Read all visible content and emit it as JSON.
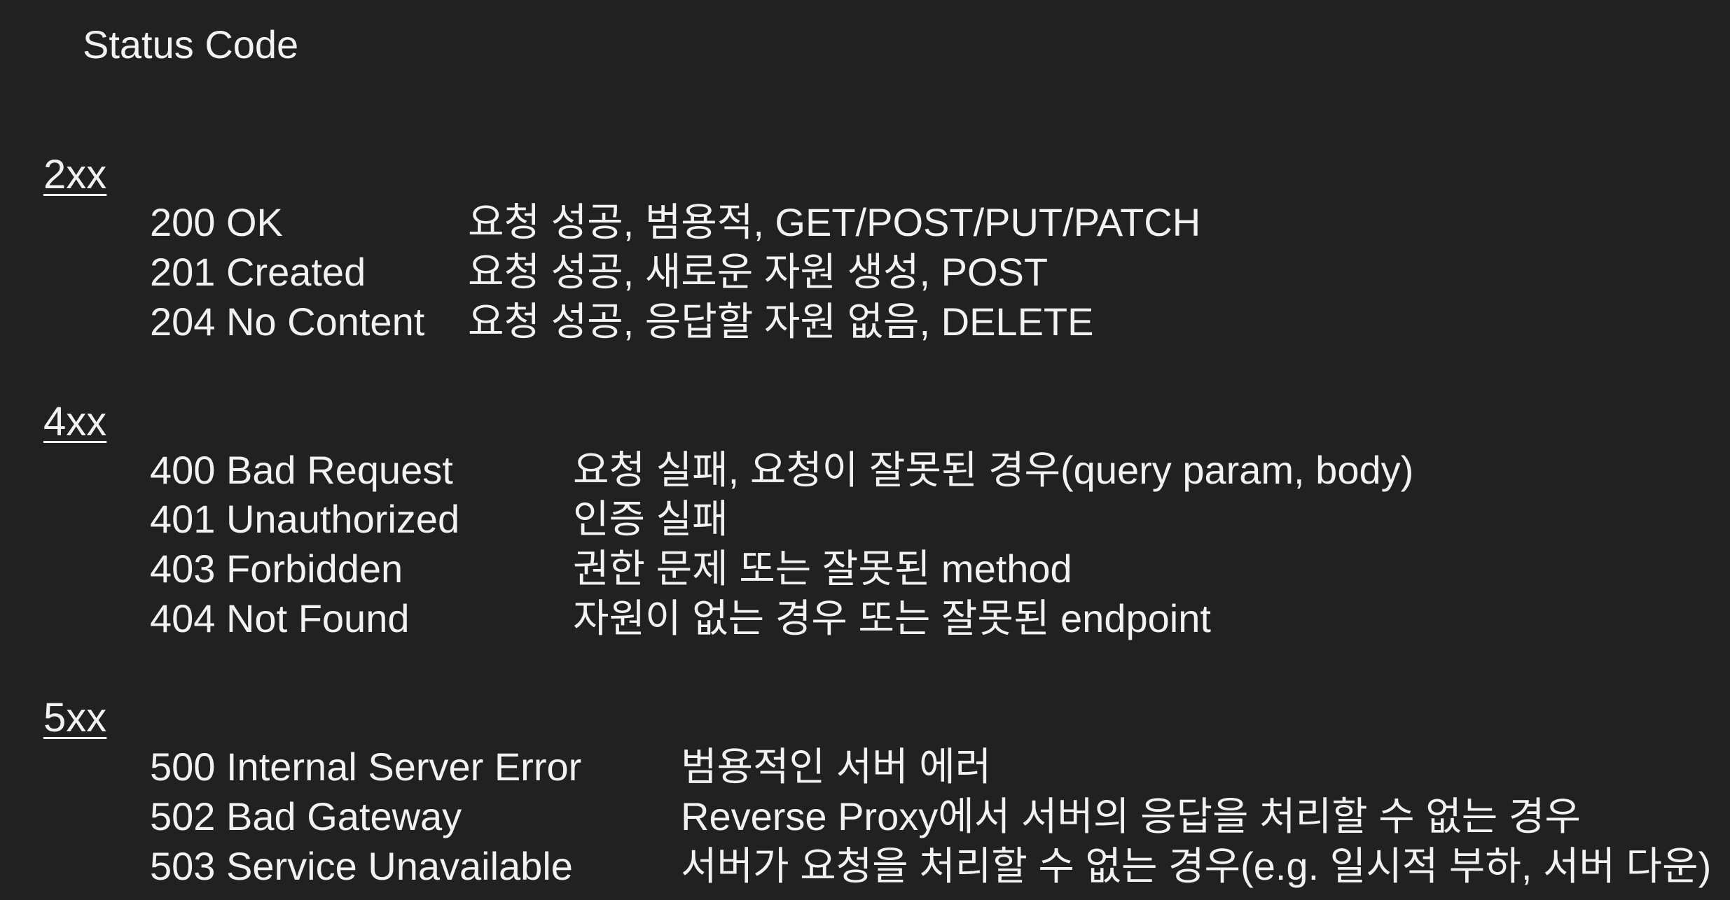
{
  "title": "Status Code",
  "sections": [
    {
      "heading": "2xx",
      "rows": [
        {
          "code": "200 OK",
          "desc": "요청 성공, 범용적, GET/POST/PUT/PATCH"
        },
        {
          "code": "201 Created",
          "desc": "요청 성공, 새로운 자원 생성, POST"
        },
        {
          "code": "204 No Content",
          "desc": "요청 성공, 응답할 자원 없음, DELETE"
        }
      ]
    },
    {
      "heading": "4xx",
      "rows": [
        {
          "code": "400 Bad Request",
          "desc": "요청 실패, 요청이 잘못된 경우(query param, body)"
        },
        {
          "code": "401 Unauthorized",
          "desc": "인증 실패"
        },
        {
          "code": "403 Forbidden",
          "desc": "권한 문제 또는 잘못된 method"
        },
        {
          "code": "404 Not Found",
          "desc": "자원이 없는 경우 또는 잘못된 endpoint"
        }
      ]
    },
    {
      "heading": "5xx",
      "rows": [
        {
          "code": "500 Internal Server Error",
          "desc": "범용적인 서버 에러"
        },
        {
          "code": "502 Bad Gateway",
          "desc": "Reverse Proxy에서 서버의 응답을 처리할 수 없는 경우"
        },
        {
          "code": "503 Service Unavailable",
          "desc": "서버가 요청을 처리할 수 없는 경우(e.g. 일시적 부하, 서버 다운)"
        }
      ]
    }
  ]
}
